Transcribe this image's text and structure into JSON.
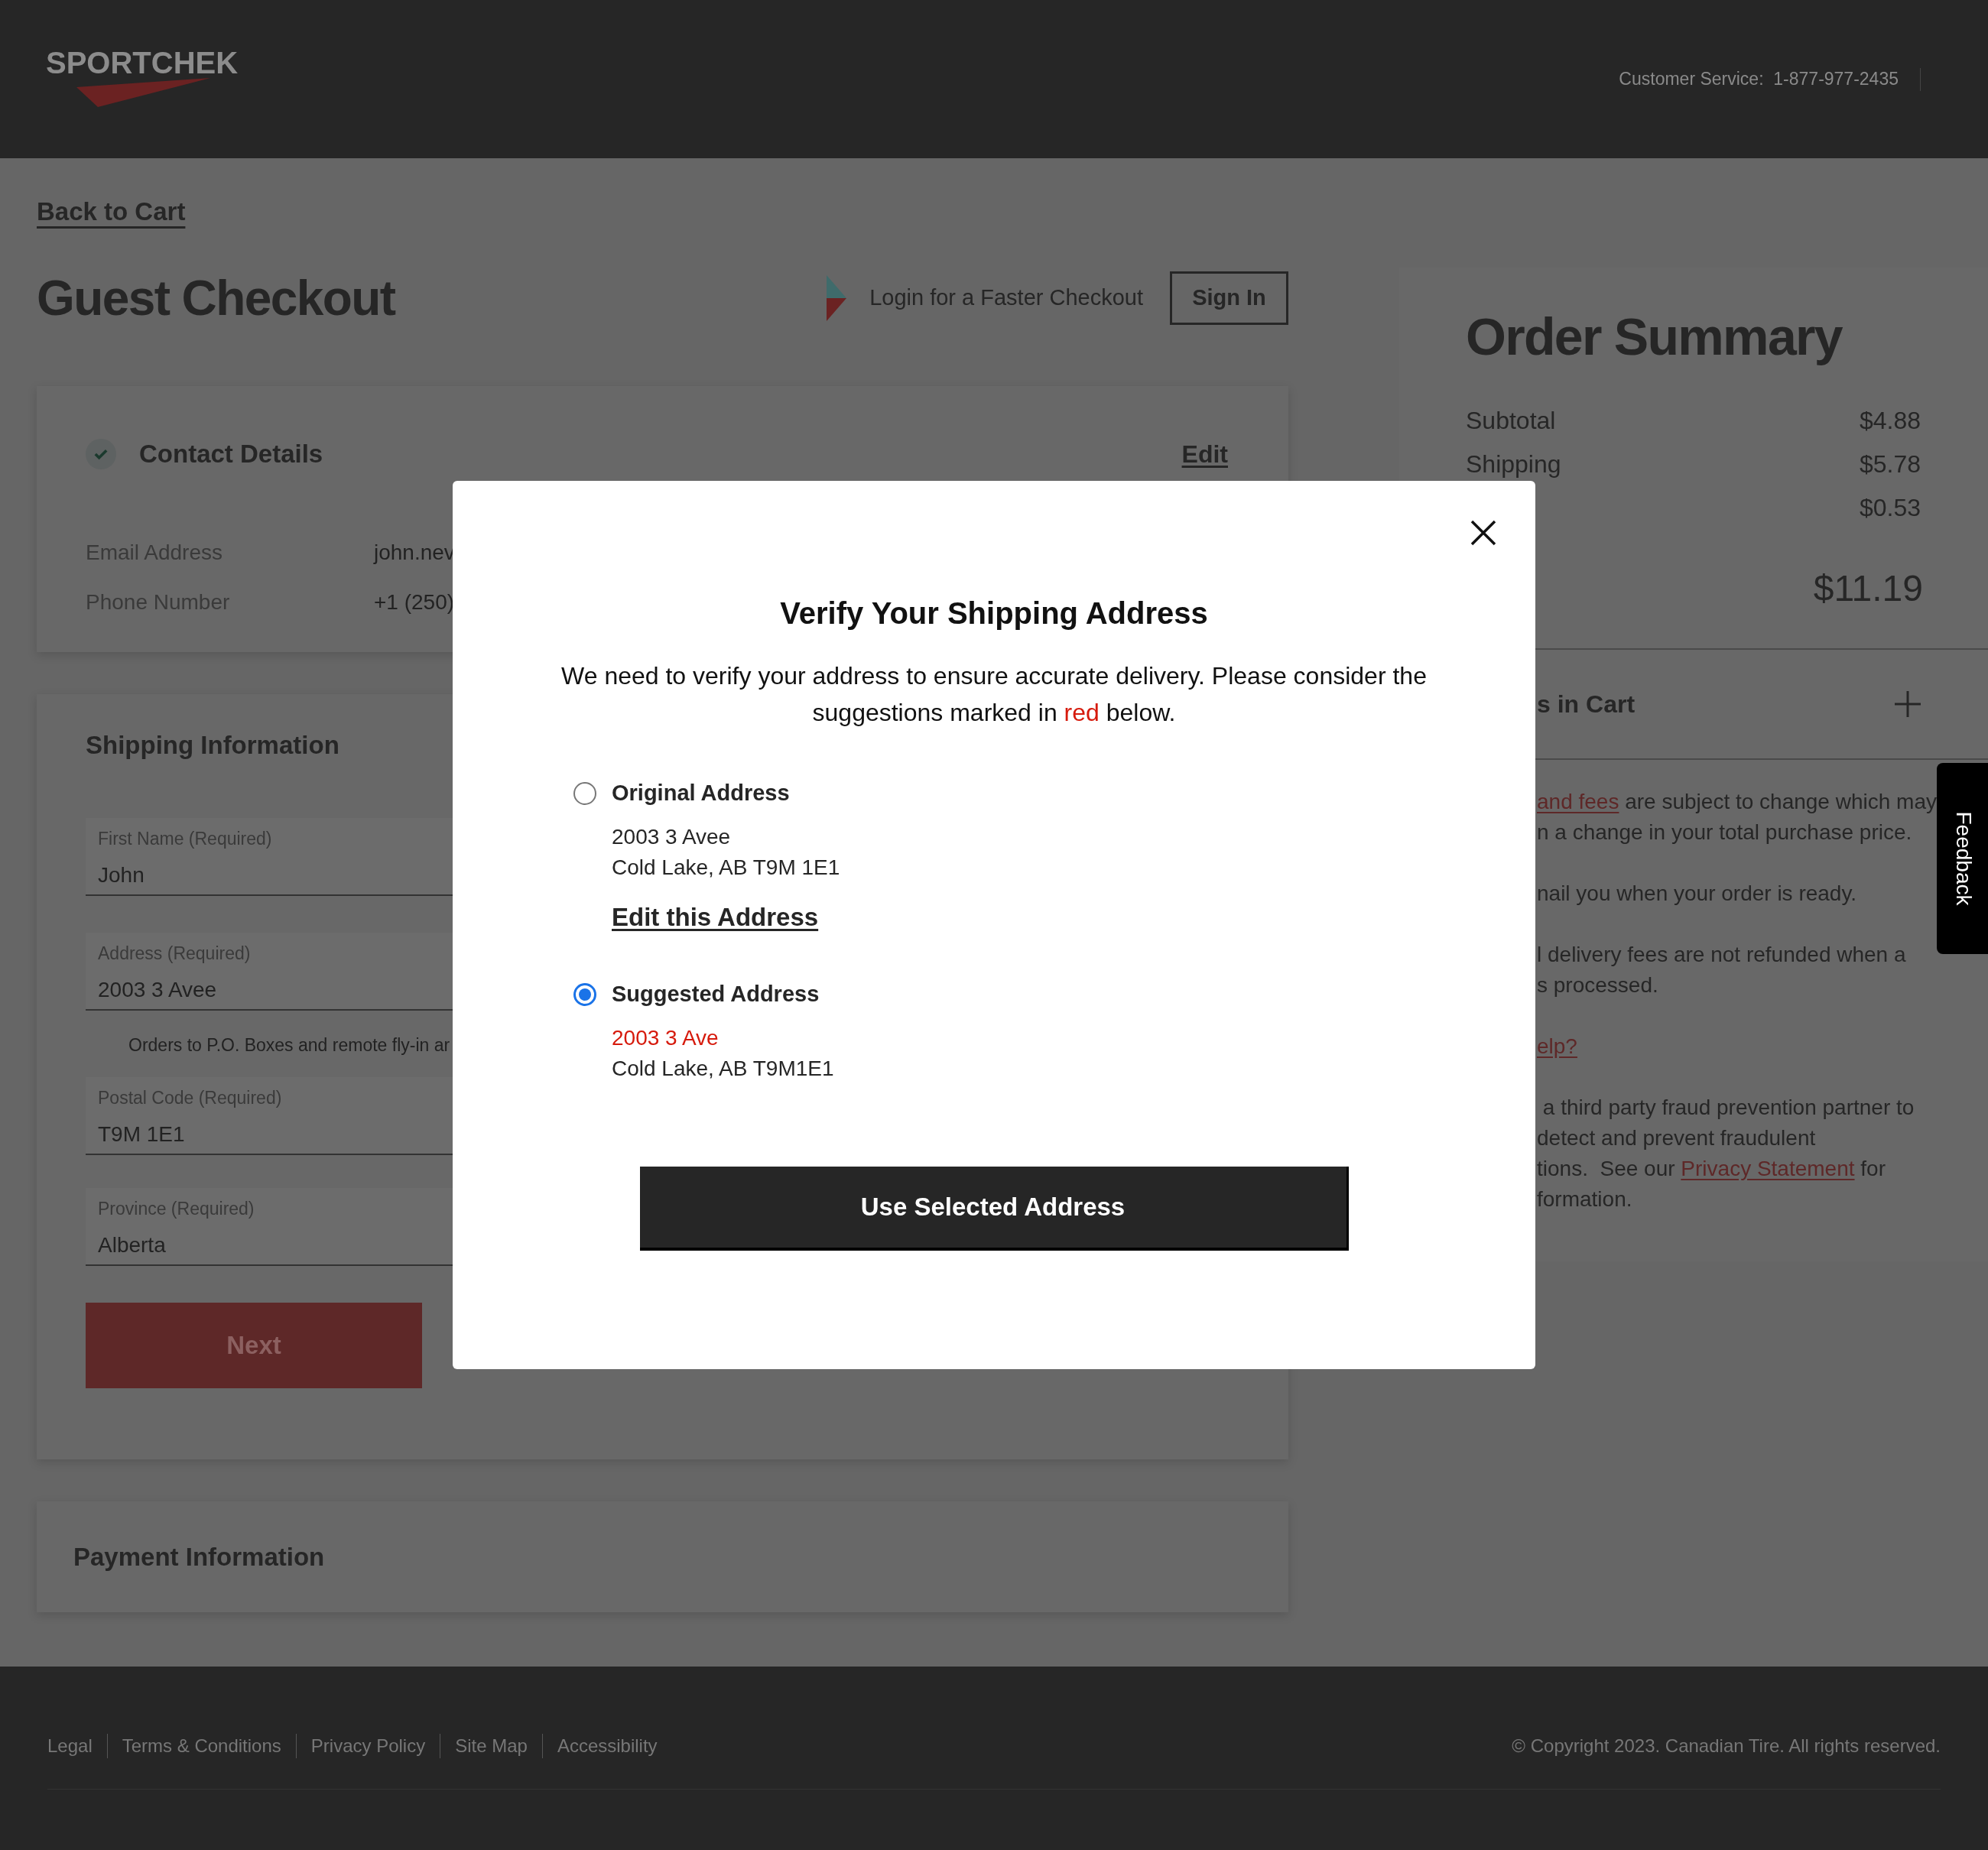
{
  "header": {
    "logo": "SPORTCHEK",
    "customer_service": "Customer Service:  1-877-977-2435"
  },
  "back_link": "Back to Cart",
  "page_title": "Guest Checkout",
  "login_prompt": "Login for a Faster Checkout",
  "sign_in_button": "Sign In",
  "contact": {
    "title": "Contact Details",
    "completed": true,
    "edit_link": "Edit",
    "rows": [
      {
        "label": "Email Address",
        "value": "john.nev"
      },
      {
        "label": "Phone Number",
        "value": "+1 (250)"
      }
    ]
  },
  "shipping": {
    "title": "Shipping Information",
    "fields": [
      {
        "label": "First Name (Required)",
        "value": "John"
      },
      {
        "label": "Address (Required)",
        "value": "2003 3 Avee"
      },
      {
        "label": "Postal Code (Required)",
        "value": "T9M 1E1"
      },
      {
        "label": "Province (Required)",
        "value": "Alberta"
      }
    ],
    "notice": "Orders to P.O. Boxes and remote fly-in ar",
    "next_button": "Next"
  },
  "payment": {
    "title": "Payment Information"
  },
  "order_summary": {
    "title": "Order Summary",
    "rows": [
      {
        "label": "Subtotal",
        "amount": "$4.88"
      },
      {
        "label": "Shipping",
        "amount": "$5.78"
      },
      {
        "amount": "$0.53"
      }
    ],
    "total": "$11.19",
    "items_header": "s in Cart",
    "notes": [
      [
        [
          {
            "text": "and fees",
            "link": true
          },
          {
            "text": " are subject to change which may",
            "link": false
          }
        ],
        [
          {
            "text": "n a change in your total purchase price.",
            "link": false
          }
        ]
      ],
      [
        [
          {
            "text": "nail you when your order is ready.",
            "link": false
          }
        ]
      ],
      [
        [
          {
            "text": "l delivery fees are not refunded when a",
            "link": false
          }
        ],
        [
          {
            "text": "s processed.",
            "link": false
          }
        ]
      ],
      [
        [
          {
            "text": "elp?",
            "link": true
          }
        ]
      ],
      [
        [
          {
            "text": " a third party fraud prevention partner to",
            "link": false
          }
        ],
        [
          {
            "text": "detect and prevent fraudulent",
            "link": false
          }
        ],
        [
          {
            "text": "tions.  See our ",
            "link": false
          },
          {
            "text": "Privacy Statement",
            "link": true
          },
          {
            "text": " for",
            "link": false
          }
        ],
        [
          {
            "text": "formation.",
            "link": false
          }
        ]
      ]
    ]
  },
  "feedback_tab": "Feedback",
  "footer": {
    "links": [
      "Legal",
      "Terms & Conditions",
      "Privacy Policy",
      "Site Map",
      "Accessibility"
    ],
    "copyright": "© Copyright 2023. Canadian Tire. All rights reserved."
  },
  "modal": {
    "title": "Verify Your Shipping Address",
    "message": [
      {
        "text": "We need to verify your address to ensure accurate delivery. Please consider the suggestions marked in ",
        "highlight": false
      },
      {
        "text": "red",
        "highlight": true
      },
      {
        "text": " below.",
        "highlight": false
      }
    ],
    "options": [
      {
        "title": "Original Address",
        "selected": false,
        "lines": [
          {
            "text": "2003 3 Avee",
            "changed": false
          },
          {
            "text": "Cold Lake, AB T9M 1E1",
            "changed": false
          }
        ],
        "edit_link": "Edit this Address"
      },
      {
        "title": "Suggested Address",
        "selected": true,
        "lines": [
          {
            "text": "2003 3 Ave",
            "changed": true
          },
          {
            "text": "Cold Lake, AB T9M1E1",
            "changed": false
          }
        ]
      }
    ],
    "button": "Use Selected Address"
  }
}
